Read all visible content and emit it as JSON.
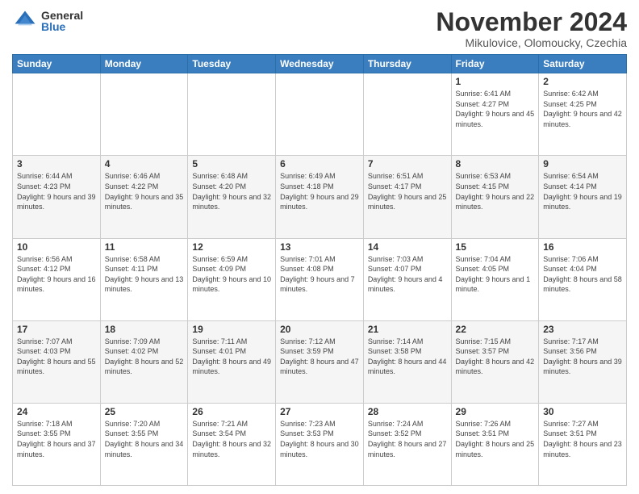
{
  "logo": {
    "general": "General",
    "blue": "Blue"
  },
  "header": {
    "month": "November 2024",
    "location": "Mikulovice, Olomoucky, Czechia"
  },
  "weekdays": [
    "Sunday",
    "Monday",
    "Tuesday",
    "Wednesday",
    "Thursday",
    "Friday",
    "Saturday"
  ],
  "weeks": [
    [
      {
        "day": "",
        "info": ""
      },
      {
        "day": "",
        "info": ""
      },
      {
        "day": "",
        "info": ""
      },
      {
        "day": "",
        "info": ""
      },
      {
        "day": "",
        "info": ""
      },
      {
        "day": "1",
        "info": "Sunrise: 6:41 AM\nSunset: 4:27 PM\nDaylight: 9 hours and 45 minutes."
      },
      {
        "day": "2",
        "info": "Sunrise: 6:42 AM\nSunset: 4:25 PM\nDaylight: 9 hours and 42 minutes."
      }
    ],
    [
      {
        "day": "3",
        "info": "Sunrise: 6:44 AM\nSunset: 4:23 PM\nDaylight: 9 hours and 39 minutes."
      },
      {
        "day": "4",
        "info": "Sunrise: 6:46 AM\nSunset: 4:22 PM\nDaylight: 9 hours and 35 minutes."
      },
      {
        "day": "5",
        "info": "Sunrise: 6:48 AM\nSunset: 4:20 PM\nDaylight: 9 hours and 32 minutes."
      },
      {
        "day": "6",
        "info": "Sunrise: 6:49 AM\nSunset: 4:18 PM\nDaylight: 9 hours and 29 minutes."
      },
      {
        "day": "7",
        "info": "Sunrise: 6:51 AM\nSunset: 4:17 PM\nDaylight: 9 hours and 25 minutes."
      },
      {
        "day": "8",
        "info": "Sunrise: 6:53 AM\nSunset: 4:15 PM\nDaylight: 9 hours and 22 minutes."
      },
      {
        "day": "9",
        "info": "Sunrise: 6:54 AM\nSunset: 4:14 PM\nDaylight: 9 hours and 19 minutes."
      }
    ],
    [
      {
        "day": "10",
        "info": "Sunrise: 6:56 AM\nSunset: 4:12 PM\nDaylight: 9 hours and 16 minutes."
      },
      {
        "day": "11",
        "info": "Sunrise: 6:58 AM\nSunset: 4:11 PM\nDaylight: 9 hours and 13 minutes."
      },
      {
        "day": "12",
        "info": "Sunrise: 6:59 AM\nSunset: 4:09 PM\nDaylight: 9 hours and 10 minutes."
      },
      {
        "day": "13",
        "info": "Sunrise: 7:01 AM\nSunset: 4:08 PM\nDaylight: 9 hours and 7 minutes."
      },
      {
        "day": "14",
        "info": "Sunrise: 7:03 AM\nSunset: 4:07 PM\nDaylight: 9 hours and 4 minutes."
      },
      {
        "day": "15",
        "info": "Sunrise: 7:04 AM\nSunset: 4:05 PM\nDaylight: 9 hours and 1 minute."
      },
      {
        "day": "16",
        "info": "Sunrise: 7:06 AM\nSunset: 4:04 PM\nDaylight: 8 hours and 58 minutes."
      }
    ],
    [
      {
        "day": "17",
        "info": "Sunrise: 7:07 AM\nSunset: 4:03 PM\nDaylight: 8 hours and 55 minutes."
      },
      {
        "day": "18",
        "info": "Sunrise: 7:09 AM\nSunset: 4:02 PM\nDaylight: 8 hours and 52 minutes."
      },
      {
        "day": "19",
        "info": "Sunrise: 7:11 AM\nSunset: 4:01 PM\nDaylight: 8 hours and 49 minutes."
      },
      {
        "day": "20",
        "info": "Sunrise: 7:12 AM\nSunset: 3:59 PM\nDaylight: 8 hours and 47 minutes."
      },
      {
        "day": "21",
        "info": "Sunrise: 7:14 AM\nSunset: 3:58 PM\nDaylight: 8 hours and 44 minutes."
      },
      {
        "day": "22",
        "info": "Sunrise: 7:15 AM\nSunset: 3:57 PM\nDaylight: 8 hours and 42 minutes."
      },
      {
        "day": "23",
        "info": "Sunrise: 7:17 AM\nSunset: 3:56 PM\nDaylight: 8 hours and 39 minutes."
      }
    ],
    [
      {
        "day": "24",
        "info": "Sunrise: 7:18 AM\nSunset: 3:55 PM\nDaylight: 8 hours and 37 minutes."
      },
      {
        "day": "25",
        "info": "Sunrise: 7:20 AM\nSunset: 3:55 PM\nDaylight: 8 hours and 34 minutes."
      },
      {
        "day": "26",
        "info": "Sunrise: 7:21 AM\nSunset: 3:54 PM\nDaylight: 8 hours and 32 minutes."
      },
      {
        "day": "27",
        "info": "Sunrise: 7:23 AM\nSunset: 3:53 PM\nDaylight: 8 hours and 30 minutes."
      },
      {
        "day": "28",
        "info": "Sunrise: 7:24 AM\nSunset: 3:52 PM\nDaylight: 8 hours and 27 minutes."
      },
      {
        "day": "29",
        "info": "Sunrise: 7:26 AM\nSunset: 3:51 PM\nDaylight: 8 hours and 25 minutes."
      },
      {
        "day": "30",
        "info": "Sunrise: 7:27 AM\nSunset: 3:51 PM\nDaylight: 8 hours and 23 minutes."
      }
    ]
  ]
}
